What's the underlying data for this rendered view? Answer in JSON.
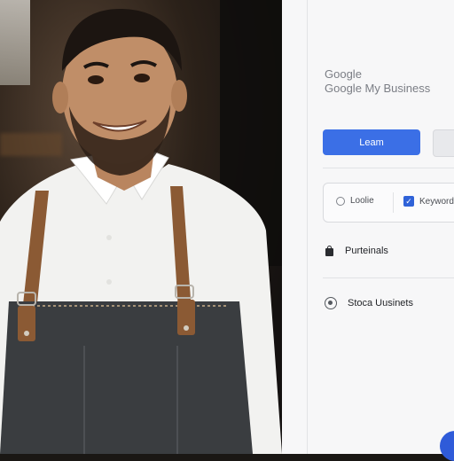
{
  "panel": {
    "brand_line1": "Google",
    "brand_line2": "Google My Business",
    "primary_button": "Leam",
    "search": {
      "location_label": "Loolie",
      "keyword_label": "Keyword"
    },
    "rows": [
      {
        "label": "Purteinals",
        "icon": "shopping-bag-icon"
      },
      {
        "label": "Stoca Uusinets",
        "icon": "google-icon"
      }
    ]
  },
  "colors": {
    "accent": "#3b6fe6",
    "panel_bg": "#f7f7f8",
    "apron": "#3a3d40",
    "strap": "#8b5a34"
  }
}
